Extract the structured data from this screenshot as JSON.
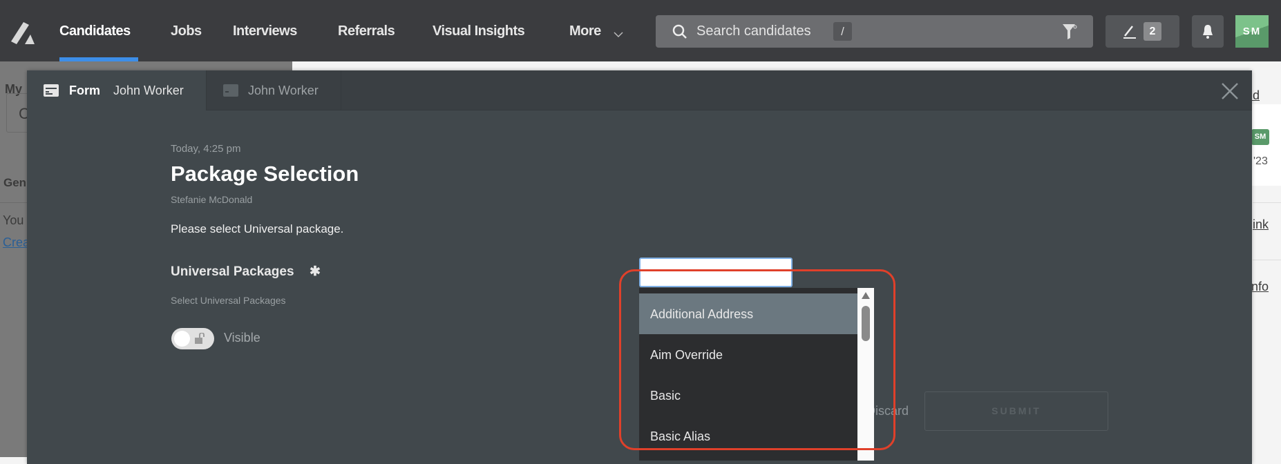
{
  "nav": {
    "items": [
      {
        "label": "Candidates",
        "active": true
      },
      {
        "label": "Jobs"
      },
      {
        "label": "Interviews"
      },
      {
        "label": "Referrals"
      },
      {
        "label": "Visual Insights"
      },
      {
        "label": "More"
      }
    ],
    "search": {
      "placeholder": "Search candidates",
      "shortcut": "/"
    },
    "edit_badge": "2",
    "avatar": "SM",
    "accent": "#3d8ee8",
    "avatar_color": "#5a9a6a"
  },
  "background": {
    "left": {
      "heading": "My",
      "box": "C",
      "section": "Gen",
      "text": "You",
      "link": "Crea"
    },
    "right": {
      "link1": "dd",
      "avatar": "SM",
      "date": "'23",
      "link2": "ink",
      "link3": "nfo"
    }
  },
  "modal": {
    "tabs": [
      {
        "type": "Form",
        "label": "John Worker",
        "active": true
      },
      {
        "label": "John Worker",
        "active": false
      }
    ],
    "timestamp": "Today, 4:25 pm",
    "title": "Package Selection",
    "author": "Stefanie McDonald",
    "instructions": "Please select Universal package.",
    "field": {
      "label": "Universal Packages",
      "required_mark": "✱",
      "help": "Select Universal Packages",
      "visibility_label": "Visible",
      "value": "",
      "options": [
        "Additional Address",
        "Aim Override",
        "Basic",
        "Basic Alias"
      ],
      "highlighted": "Additional Address"
    },
    "discard_label": "Discard",
    "submit_label": "SUBMIT"
  }
}
